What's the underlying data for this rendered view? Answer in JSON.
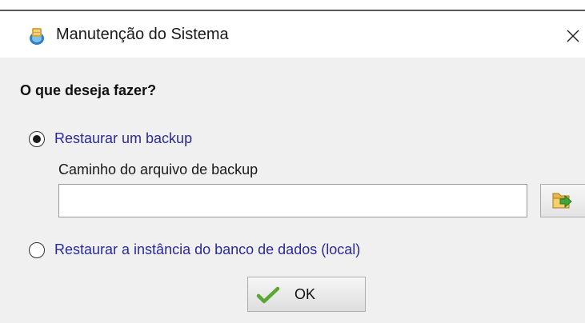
{
  "window": {
    "title": "Manutenção do Sistema",
    "close_label": "×"
  },
  "icons": {
    "app": "db-maintenance-icon",
    "close": "close-icon",
    "browse": "open-folder-icon",
    "ok": "check-icon"
  },
  "form": {
    "question": "O que deseja fazer?",
    "option_backup": {
      "label": "Restaurar um backup",
      "selected": true
    },
    "backup_path": {
      "label": "Caminho do arquivo de backup",
      "value": "",
      "placeholder": ""
    },
    "option_instance": {
      "label": "Restaurar a instância do banco de dados (local)",
      "selected": false
    },
    "ok_label": "OK"
  },
  "colors": {
    "option_text": "#2a2a9a",
    "client_bg": "#f0f0f0",
    "check_green": "#5aa832"
  }
}
